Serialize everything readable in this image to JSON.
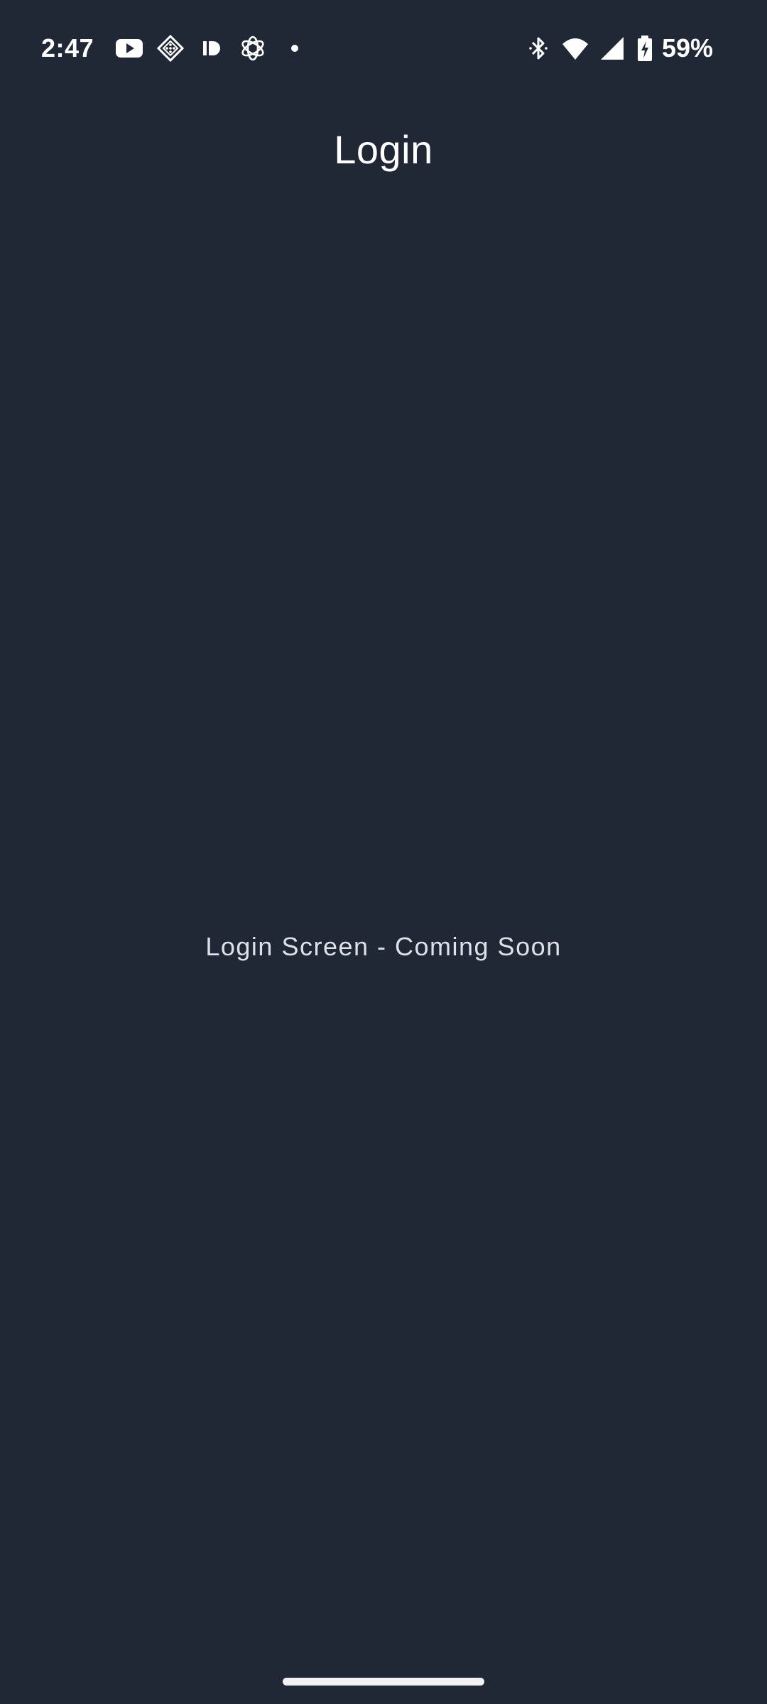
{
  "theme": {
    "background": "#202836",
    "text_primary": "#ffffff",
    "text_secondary": "#dde1e8"
  },
  "status_bar": {
    "time": "2:47",
    "notification_icons": [
      "youtube-icon",
      "diamond-app-icon",
      "patreon-icon",
      "openai-icon",
      "more-dot-icon"
    ],
    "system_icons": [
      "bluetooth-icon",
      "wifi-icon",
      "cell-signal-icon",
      "battery-charging-icon"
    ],
    "battery_level": "59%"
  },
  "app_bar": {
    "title": "Login"
  },
  "main": {
    "message": "Login Screen - Coming Soon"
  },
  "navigation": {
    "type": "gesture-handle"
  }
}
